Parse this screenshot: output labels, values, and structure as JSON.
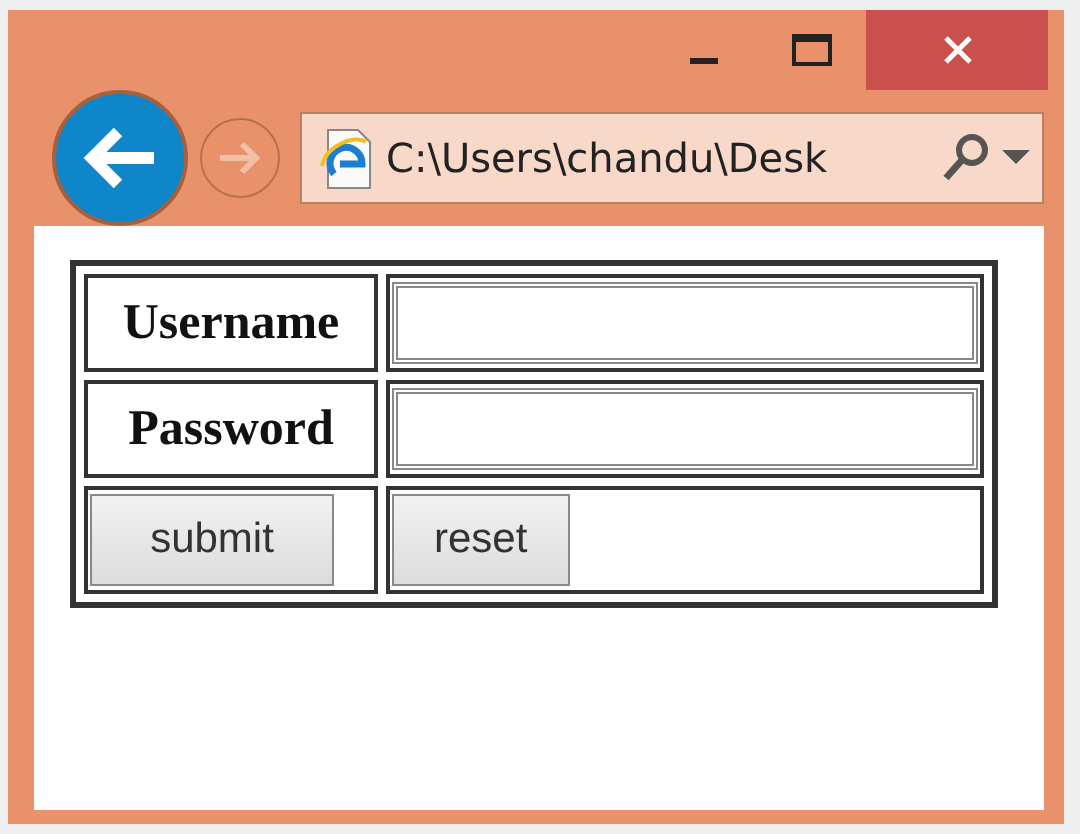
{
  "window": {
    "address": "C:\\Users\\chandu\\Desk"
  },
  "form": {
    "fields": [
      {
        "label": "Username"
      },
      {
        "label": "Password"
      }
    ],
    "buttons": [
      "submit",
      "reset"
    ]
  }
}
